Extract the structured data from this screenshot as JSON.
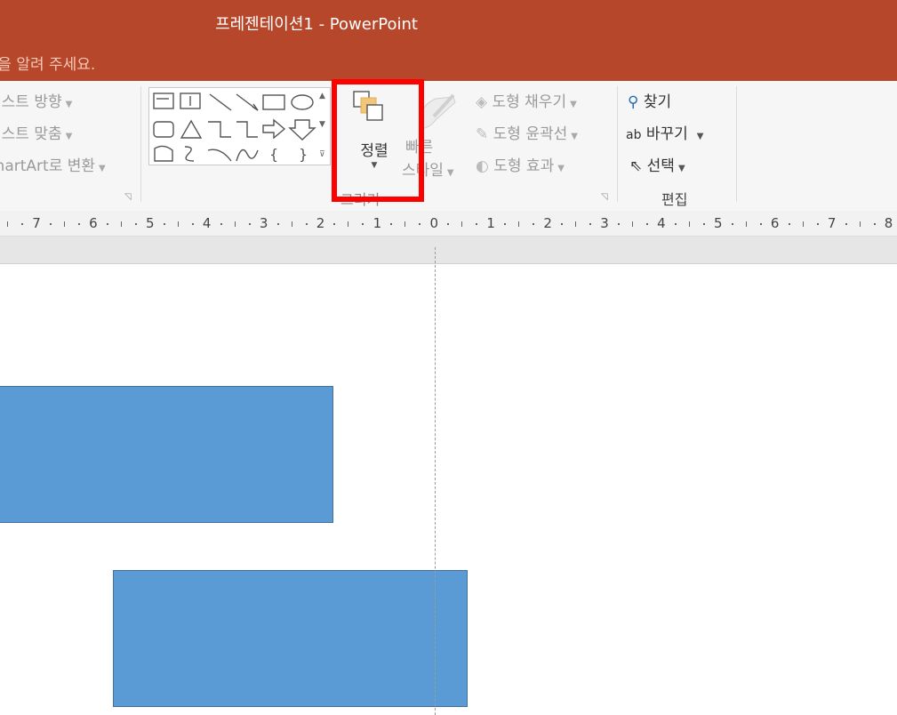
{
  "window": {
    "title": "프레젠테이션1 - PowerPoint",
    "tell_me": "작업을 알려 주세요."
  },
  "ribbon": {
    "paragraph": {
      "text_direction": "텍스트 방향",
      "align_text": "텍스트 맞춤",
      "smartart": "SmartArt로 변환"
    },
    "drawing": {
      "group_label": "그리기",
      "arrange_label": "정렬",
      "quick_styles_line1": "빠른",
      "quick_styles_line2": "스타일",
      "shape_fill": "도형 채우기",
      "shape_outline": "도형 윤곽선",
      "shape_effects": "도형 효과"
    },
    "editing": {
      "group_label": "편집",
      "find": "찾기",
      "replace": "바꾸기",
      "select": "선택"
    }
  },
  "ruler": {
    "labels": [
      "7",
      "6",
      "5",
      "4",
      "3",
      "2",
      "1",
      "0",
      "1",
      "2",
      "3",
      "4",
      "5",
      "6",
      "7",
      "8"
    ]
  },
  "colors": {
    "title_bar": "#b7472a",
    "highlight": "#ff0000",
    "shape_fill": "#5b9bd5",
    "shape_border": "#41719c"
  },
  "annotation": {
    "highlight_target": "arrange-button"
  }
}
